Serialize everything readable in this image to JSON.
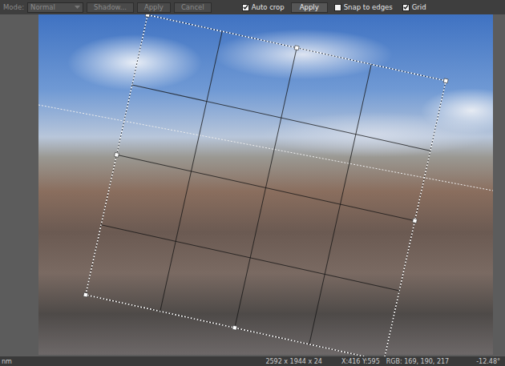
{
  "toolbar": {
    "mode": {
      "label": "Mode:",
      "value": "Normal"
    },
    "buttons": [
      {
        "label": "Shadow...",
        "disabled": true
      },
      {
        "label": "Apply",
        "disabled": true
      },
      {
        "label": "Cancel",
        "disabled": true
      }
    ],
    "options": [
      {
        "kind": "checkbox",
        "label": "Auto crop",
        "checked": true
      },
      {
        "kind": "button",
        "label": "Apply"
      },
      {
        "kind": "checkbox",
        "label": "Snap to edges",
        "checked": false
      },
      {
        "kind": "checkbox",
        "label": "Grid",
        "checked": true
      }
    ]
  },
  "status_bar": {
    "unit": "nm",
    "dimensions": "2592 x 1944 x 24",
    "position": "X:416 Y:595",
    "color": "RGB: 169, 190, 217",
    "angle": "-12.48°"
  }
}
